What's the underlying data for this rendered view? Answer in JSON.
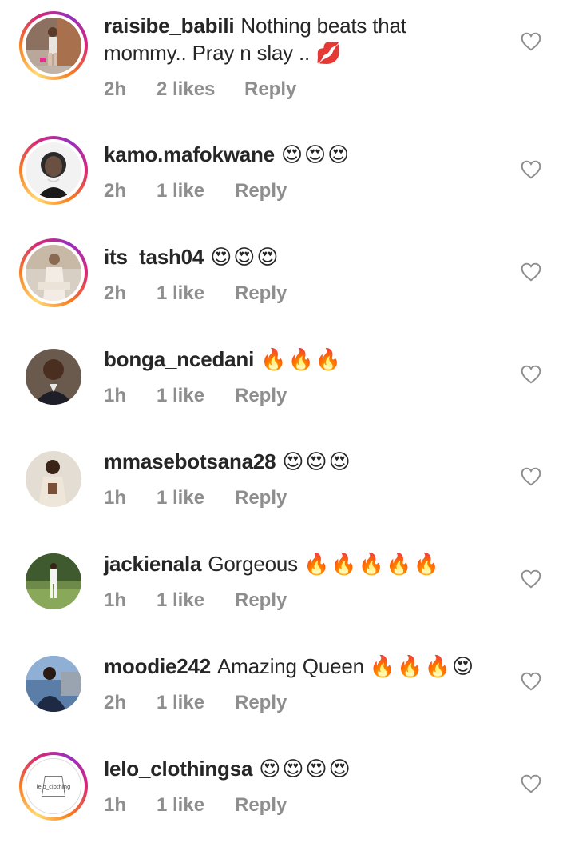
{
  "comments": [
    {
      "username": "raisibe_babili",
      "text": "Nothing beats that mommy.. Pray n slay ..",
      "text_line1": "Nothing beats that",
      "text_line2": "mommy.. Pray n slay ..",
      "emoji": "💋",
      "time": "2h",
      "likes": "2 likes",
      "reply": "Reply"
    },
    {
      "username": "kamo.mafokwane",
      "text": "",
      "emoji": "😍😍😍",
      "time": "2h",
      "likes": "1 like",
      "reply": "Reply"
    },
    {
      "username": "its_tash04",
      "text": "",
      "emoji": "😍😍😍",
      "time": "2h",
      "likes": "1 like",
      "reply": "Reply"
    },
    {
      "username": "bonga_ncedani",
      "text": "",
      "emoji": "🔥🔥🔥",
      "time": "1h",
      "likes": "1 like",
      "reply": "Reply"
    },
    {
      "username": "mmasebotsana28",
      "text": "",
      "emoji": "😍😍😍",
      "time": "1h",
      "likes": "1 like",
      "reply": "Reply"
    },
    {
      "username": "jackienala",
      "text": "Gorgeous",
      "emoji": "🔥🔥🔥🔥🔥",
      "time": "1h",
      "likes": "1 like",
      "reply": "Reply"
    },
    {
      "username": "moodie242",
      "text": "Amazing Queen",
      "emoji": "🔥🔥🔥😍",
      "time": "2h",
      "likes": "1 like",
      "reply": "Reply"
    },
    {
      "username": "lelo_clothingsa",
      "text": "",
      "emoji": "😍😍😍😍",
      "time": "1h",
      "likes": "1 like",
      "reply": "Reply",
      "avatar_text": "lelo_clothing"
    }
  ],
  "colors": {
    "text": "#262626",
    "meta": "#8e8e8e",
    "story_ring_start": "#feda75",
    "story_ring_mid": "#d62976",
    "story_ring_end": "#962fbf"
  },
  "icons": {
    "like": "heart-outline-icon"
  }
}
